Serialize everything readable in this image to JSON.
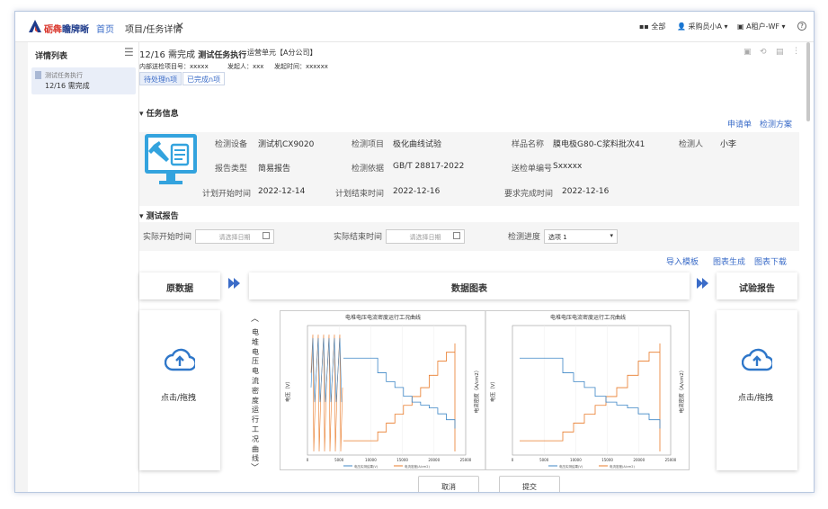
{
  "header": {
    "logo_text": "砺犇",
    "logo_text_rest": "瞻牌晰",
    "nav_home": "首页",
    "nav_current": "项目/任务详情",
    "close": "✕",
    "all": "全部",
    "user": "采购员小A",
    "tenant": "A租户-WF",
    "help": "?"
  },
  "sidebar": {
    "title": "详情列表",
    "item_line1": "测试任务执行",
    "item_line2": "12/16 需完成"
  },
  "task": {
    "heading_date": "12/16 需完成",
    "heading_name": "测试任务执行",
    "unit": "运营单元【A分公司】",
    "meta1": "内部送检项目号：xxxxx",
    "meta2": "发起人：xxx",
    "meta3": "发起时间：xxxxxx",
    "tab_pending": "待处理n项",
    "tab_done": "已完成n项"
  },
  "info": {
    "title": "▾ 任务信息",
    "link_apply": "申请单",
    "link_plan": "检测方案",
    "device_label": "检测设备",
    "device": "测试机CX9020",
    "item_label": "检测项目",
    "item": "极化曲线试验",
    "sample_label": "样品名称",
    "sample": "膜电极G80-C浆料批次41",
    "inspector_label": "检测人",
    "inspector": "小李",
    "report_type_label": "报告类型",
    "report_type": "简易报告",
    "basis_label": "检测依据",
    "basis": "GB/T 28817-2022",
    "order_label": "送检单编号",
    "order": "Sxxxxx",
    "plan_start_label": "计划开始时间",
    "plan_start": "2022-12-14",
    "plan_end_label": "计划结束时间",
    "plan_end": "2022-12-16",
    "req_done_label": "要求完成时间",
    "req_done": "2022-12-16"
  },
  "report": {
    "title": "▾ 测试报告",
    "start_label": "实际开始时间",
    "end_label": "实际结束时间",
    "date_placeholder": "请选择日期",
    "progress_label": "检测进度",
    "progress_value": "选项 1",
    "import": "导入模板",
    "gen": "图表生成",
    "download": "图表下载"
  },
  "flow": {
    "raw": "原数据",
    "chart": "数据图表",
    "result": "试验报告",
    "upload_text": "点击/拖拽",
    "side_label": "电堆电压电流密度运行工况曲线"
  },
  "chart_data": {
    "type": "line",
    "title": "电堆电压电流密度运行工况曲线",
    "ylabel": "电压（V）",
    "y2label": "电流密度（A/cm2）",
    "legend": [
      "电压实测结果(V)",
      "电流密度(A/cm2)"
    ],
    "colors": [
      "#3d86c6",
      "#e97b2a"
    ],
    "xticks": [
      "0",
      "5000",
      "10000",
      "15000",
      "20000",
      "25000"
    ],
    "series": [
      {
        "name": "电压实测结果(V)",
        "values": [
          0.6,
          0.6,
          0.6,
          0.6,
          0.55,
          0.52,
          0.5,
          0.47,
          0.45,
          0.44,
          0.43,
          0.41,
          0.39,
          0.36
        ]
      },
      {
        "name": "电流密度(A/cm2)",
        "values": [
          0.05,
          0.05,
          0.05,
          0.05,
          0.1,
          0.15,
          0.2,
          0.25,
          0.3,
          0.35,
          0.42,
          0.5,
          0.55,
          0.6
        ]
      }
    ]
  },
  "buttons": {
    "cancel": "取消",
    "submit": "提交"
  }
}
